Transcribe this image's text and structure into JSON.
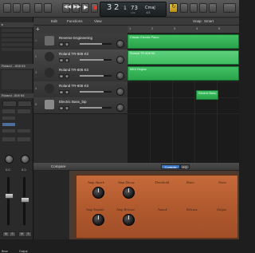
{
  "toolbar": {
    "lcd_bar": "3",
    "lcd_beat": "2",
    "lcd_sub": "1",
    "lcd_tempo": "73",
    "lcd_tempo_label": "100",
    "lcd_key": "Cmaj",
    "lcd_sig": "4/4"
  },
  "menu": {
    "edit": "Edit",
    "functions": "Functions",
    "view": "View",
    "snap": "Snap:",
    "snap_value": "Smart"
  },
  "inspector": {
    "region_label": "Roland ...808 Kit",
    "region_label2": "Roland...808 Kit",
    "bottom_left": "Bnce",
    "bottom_right": "Output",
    "out_left": "Roland ...808 Kit",
    "out_right": "Output"
  },
  "tracks": [
    {
      "num": "1",
      "name": "Reverse Engineering",
      "color": "#6aa0d8"
    },
    {
      "num": "2",
      "name": "Roland TR-808 Kit",
      "color": "#3a3a3a"
    },
    {
      "num": "3",
      "name": "Roland TR-808 Kit",
      "color": "#3a3a3a"
    },
    {
      "num": "4",
      "name": "Roland TR-808 Kit",
      "color": "#3a3a3a"
    },
    {
      "num": "5",
      "name": "Electric Bass_bip",
      "color": "#8a8a8a"
    }
  ],
  "regions": {
    "r1": "Classic Electric Piano",
    "r2": "Roland TR-808 Kit",
    "r3": "MIDI Region",
    "r5": "Electric Bass..."
  },
  "ruler": [
    "1",
    "2",
    "3",
    "4",
    "5"
  ],
  "editor": {
    "tab": "Compare",
    "controls": "Controls",
    "eq": "EQ"
  },
  "amp": {
    "top_labels": [
      "Amp Attack",
      "Amp Decay",
      "Threshold",
      "Ratio",
      "Noise"
    ],
    "bottom_labels": [
      "Amp Sustain",
      "Amp Release",
      "Attack",
      "Release",
      "Output"
    ]
  },
  "colors": {
    "region_green": "#2aa34a",
    "amp_orange": "#b25a2f"
  }
}
